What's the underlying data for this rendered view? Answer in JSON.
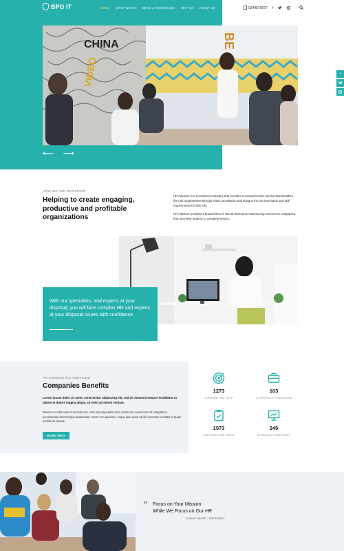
{
  "brand": {
    "name": "BPO IT"
  },
  "nav": {
    "items": [
      "HOME",
      "WHAT WE DO",
      "NEWS & RESOURCES",
      "WHY US",
      "ABOUT US"
    ],
    "phone": "0244576677"
  },
  "hero": {
    "prev": "⟵",
    "next": "⟶"
  },
  "intro": {
    "eyebrow": "HOW WE ARE DIFFERENT",
    "title": "Helping to create engaging, productive and profitable organizations",
    "p1": "HR Advisors is a recruitment company that provides a comprehensive service that identifies the role requirements through initial consultation and designs the job description and skill requirements for that role.",
    "p2": "HR Advisors provides a broad menu of Human Resource Outsourcing Services to companies, from one-time projects to complete service."
  },
  "callout": {
    "text": "With our specialists, and experts at your disposal, you will face complex HR and experts at your disposal issues with confidence"
  },
  "benefits": {
    "eyebrow": "HR CONSULTING SERVICES",
    "title": "Companies Benefits",
    "bold": "Lorem ipsum dolor sit amet, consectetur adipiscing elit, sed do eiusmod tempor incididunt ut labore et dolore magna aliqua. Ut enim ad minim veniam.",
    "text": "Deserunt mollit anim id est laborum. Sed ut perspiciatis unde omnis iste natus error sit voluptatem accusantium doloremque laudantium, totam rem aperiam, eaque ipsa quae ab illo inventore veritatis et quasi architecto beatae.",
    "button": "MORE INFO",
    "stats": [
      {
        "num": "1273",
        "label": "COMPANY WE HELP",
        "icon": "target-icon"
      },
      {
        "num": "103",
        "label": "CORPORATE PROGRAMS",
        "icon": "briefcase-icon"
      },
      {
        "num": "1573",
        "label": "CONTRACT WE WORK",
        "icon": "clipboard-icon"
      },
      {
        "num": "245",
        "label": "STRATEGIC PARTNERS",
        "icon": "presentation-icon"
      }
    ]
  },
  "testimonial": {
    "quote_line1": "Focus on Your Mission",
    "quote_line2": "While We Focus on Our HR",
    "author": "TOBIAS WHITE - PRESIDENT"
  },
  "colors": {
    "accent": "#26b1ad",
    "active_nav": "#ffe36e",
    "light_bg": "#eef2f6"
  }
}
